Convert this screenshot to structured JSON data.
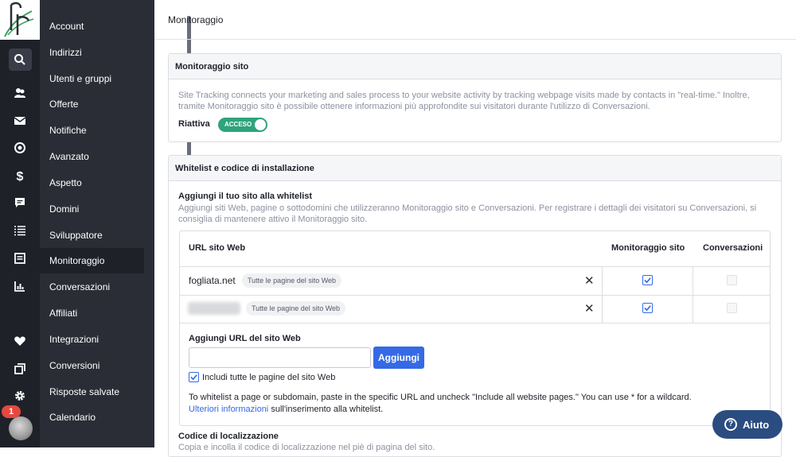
{
  "header": {
    "title": "Monitoraggio"
  },
  "menu": {
    "items": [
      "Account",
      "Indirizzi",
      "Utenti e gruppi",
      "Offerte",
      "Notifiche",
      "Avanzato",
      "Aspetto",
      "Domini",
      "Sviluppatore",
      "Monitoraggio",
      "Conversazioni",
      "Affiliati",
      "Integrazioni",
      "Conversioni",
      "Risposte salvate",
      "Calendario"
    ],
    "active": "Monitoraggio"
  },
  "rail": {
    "icons": [
      "search-icon",
      "contacts-icon",
      "mail-icon",
      "target-icon",
      "dollar-icon",
      "chat-icon",
      "list-icon",
      "document-icon",
      "chart-icon",
      "heart-icon",
      "pages-icon",
      "gear-icon"
    ],
    "notification_count": "1"
  },
  "site_tracking": {
    "title": "Monitoraggio sito",
    "description_1": "Site Tracking connects your marketing and sales process to your website activity by tracking webpage visits made by contacts in \"real-time.\" Inoltre,",
    "description_2": "tramite Monitoraggio sito è possibile ottenere informazioni più approfondite sui visitatori durante l'utilizzo di Conversazioni.",
    "reactivate_label": "Riattiva",
    "toggle_label": "ACCESO"
  },
  "whitelist": {
    "title": "Whitelist e codice di installazione",
    "add_title": "Aggiungi il tuo sito alla whitelist",
    "add_desc_1": "Aggiungi siti Web, pagine o sottodomini che utilizzeranno Monitoraggio sito e Conversazioni. Per registrare i dettagli dei visitatori su Conversazioni, si",
    "add_desc_2": "consiglia di mantenere attivo il Monitoraggio sito.",
    "columns": {
      "url": "URL sito Web",
      "tracking": "Monitoraggio sito",
      "conversations": "Conversazioni"
    },
    "rows": [
      {
        "url": "fogliata.net",
        "scope": "Tutte le pagine del sito Web",
        "tracking": true,
        "conversations": false
      },
      {
        "url": "",
        "scope": "Tutte le pagine del sito Web",
        "tracking": true,
        "conversations": false
      }
    ],
    "add_url_label": "Aggiungi URL del sito Web",
    "url_input_value": "",
    "add_button": "Aggiungi",
    "include_all_label": "Includi tutte le pagine del sito Web",
    "include_all_checked": true,
    "help_text": "To whitelist a page or subdomain, paste in the specific URL and uncheck \"Include all website pages.\" You can use * for a wildcard.",
    "help_link": "Ulteriori informazioni",
    "help_link_suffix": "sull'inserimento alla whitelist.",
    "code_title": "Codice di localizzazione",
    "code_desc": "Copia e incolla il codice di localizzazione nel piè di pagina del sito."
  },
  "help_button": {
    "label": "Aiuto",
    "icon": "?"
  },
  "colors": {
    "accent": "#356ae6",
    "toggle_on": "#2fa37c",
    "rail_bg": "#1f2129",
    "menu_bg": "#2b2d36",
    "help_bg": "#2b4c80"
  }
}
